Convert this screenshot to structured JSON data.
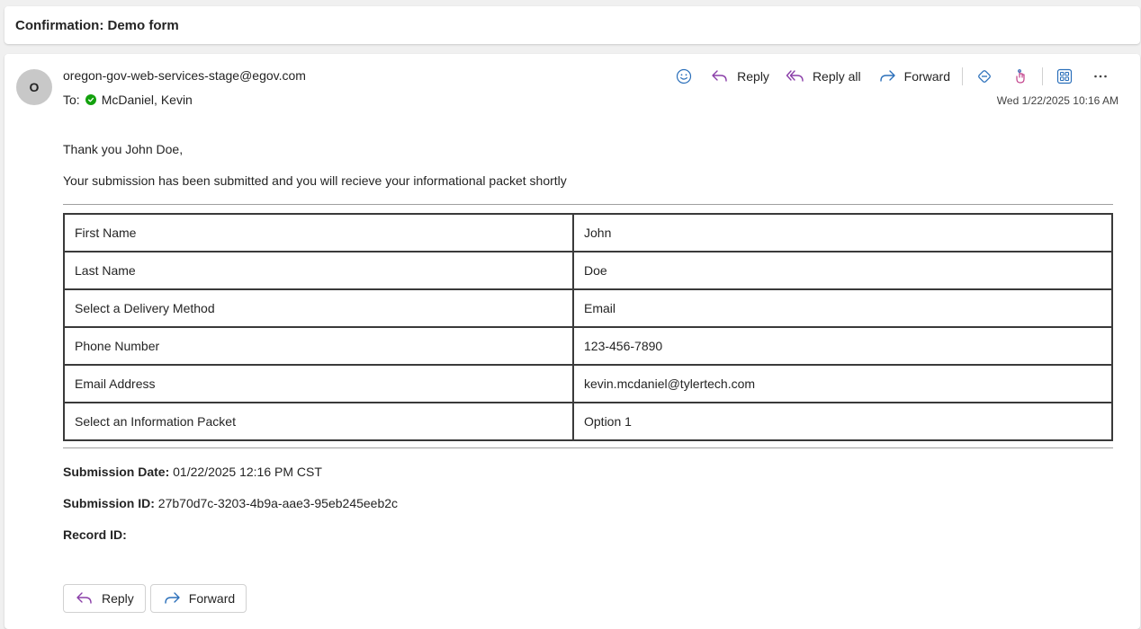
{
  "subject": "Confirmation: Demo form",
  "sender": {
    "avatar_initial": "O",
    "email": "oregon-gov-web-services-stage@egov.com"
  },
  "recipient": {
    "to_label": "To:",
    "name": "McDaniel, Kevin"
  },
  "toolbar": {
    "reply": "Reply",
    "reply_all": "Reply all",
    "forward": "Forward"
  },
  "timestamp": "Wed 1/22/2025 10:16 AM",
  "body": {
    "greeting": "Thank you John Doe,",
    "intro": "Your submission has been submitted and you will recieve your informational packet shortly",
    "fields": [
      {
        "label": "First Name",
        "value": "John"
      },
      {
        "label": "Last Name",
        "value": "Doe"
      },
      {
        "label": "Select a Delivery Method",
        "value": "Email"
      },
      {
        "label": "Phone Number",
        "value": "123-456-7890"
      },
      {
        "label": "Email Address",
        "value": "kevin.mcdaniel@tylertech.com"
      },
      {
        "label": "Select an Information Packet",
        "value": "Option 1"
      }
    ],
    "submission_date_label": "Submission Date:",
    "submission_date": "01/22/2025 12:16 PM CST",
    "submission_id_label": "Submission ID:",
    "submission_id": "27b70d7c-3203-4b9a-aae3-95eb245eeb2c",
    "record_id_label": "Record ID:",
    "record_id": ""
  },
  "actions": {
    "reply": "Reply",
    "forward": "Forward"
  },
  "colors": {
    "reply_icon": "#8a3ea8",
    "forward_icon": "#2a6fba",
    "presence_green": "#13a10e"
  }
}
